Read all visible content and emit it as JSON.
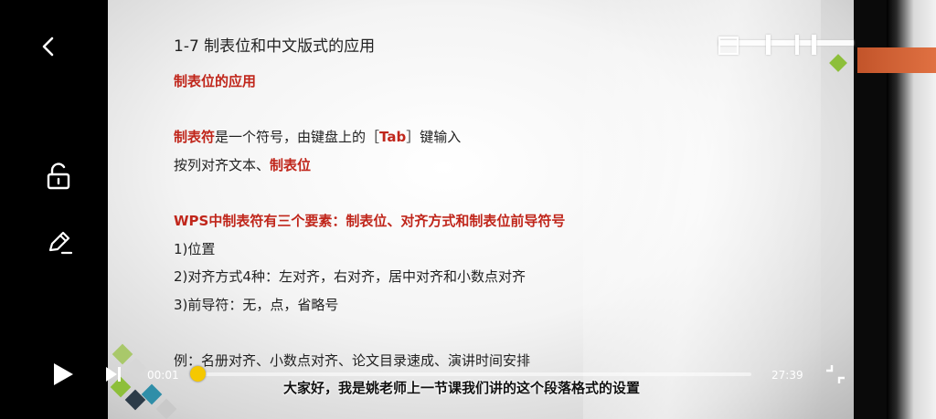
{
  "slide": {
    "title": "1-7 制表位和中文版式的应用",
    "section_heading": "制表位的应用",
    "line1_term": "制表符",
    "line1_rest_a": "是一个符号，由键盘上的［",
    "line1_key": "Tab",
    "line1_rest_b": "］键输入",
    "line2_a": "按列对齐文本、",
    "line2_term": "制表位",
    "elements_heading": "WPS中制表符有三个要素：制表位、对齐方式和制表位前导符号",
    "item1": "1)位置",
    "item2": "2)对齐方式4种：左对齐，右对齐，居中对齐和小数点对齐",
    "item3": "3)前导符：无，点，省略号",
    "example": "例：名册对齐、小数点对齐、论文目录速成、演讲时间安排"
  },
  "player": {
    "current_time": "00:01",
    "total_time": "27:39",
    "progress_fraction": 0.003,
    "subtitle": "大家好，我是姚老师上一节课我们讲的这个段落格式的设置"
  },
  "icons": {
    "back": "back-arrow-icon",
    "lock": "unlock-icon",
    "edit": "pen-edit-icon",
    "play": "play-icon",
    "next": "next-episode-icon",
    "fullscreen": "fullscreen-exit-icon"
  },
  "colors": {
    "accent_red": "#c0261b",
    "progress_yellow": "#f3c400"
  }
}
